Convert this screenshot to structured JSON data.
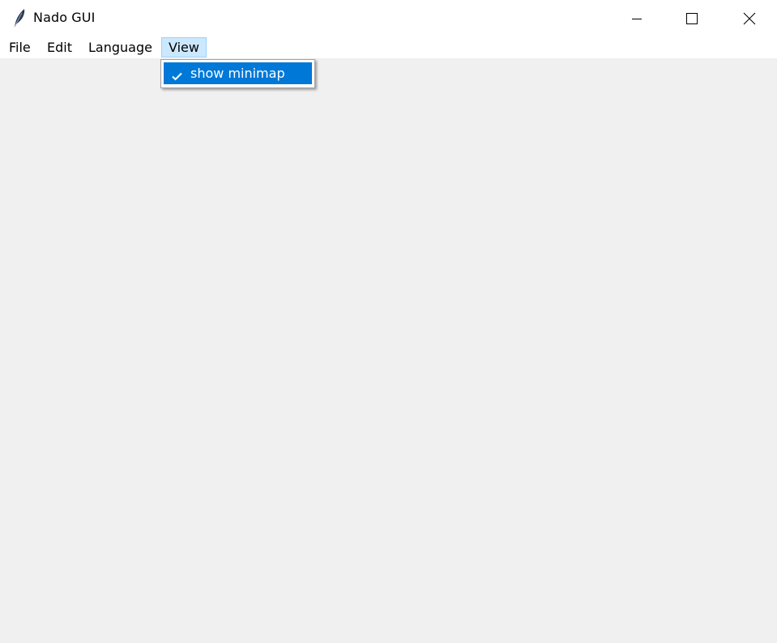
{
  "window": {
    "title": "Nado GUI",
    "icon": "feather-icon",
    "controls": {
      "minimize": "minimize-icon",
      "maximize": "maximize-icon",
      "close": "close-icon"
    }
  },
  "menubar": {
    "items": [
      {
        "label": "File"
      },
      {
        "label": "Edit"
      },
      {
        "label": "Language"
      },
      {
        "label": "View",
        "active": true
      }
    ]
  },
  "view_menu": {
    "items": [
      {
        "label": "show minimap",
        "checked": true,
        "icon": "checkmark-icon",
        "highlighted": true
      }
    ]
  },
  "colors": {
    "highlight": "#0078d7",
    "active_menu_bg": "#cce8ff",
    "active_menu_border": "#99d1ff",
    "client_bg": "#f0f0f0"
  }
}
